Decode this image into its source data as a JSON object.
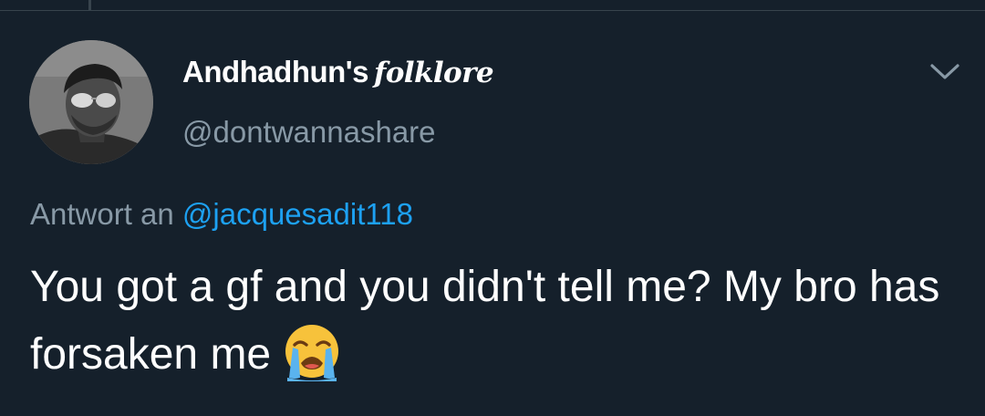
{
  "tweet": {
    "author": {
      "display_name": "Andhadhun's",
      "display_name_styled": "folklore",
      "handle": "@dontwannashare"
    },
    "reply_to": {
      "prefix": "Antwort an",
      "handle": "@jacquesadit118"
    },
    "text": "You got a gf and you didn't tell me? My bro has forsaken me",
    "emoji": "loudly-crying-face"
  },
  "icons": {
    "menu": "chevron-down-icon"
  },
  "colors": {
    "background": "#15202b",
    "primary_text": "#ffffff",
    "secondary_text": "#8899a6",
    "link": "#1da1f2",
    "border": "#38444d"
  }
}
